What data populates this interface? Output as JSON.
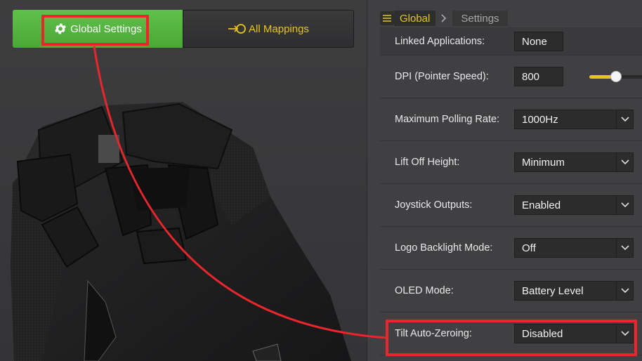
{
  "header": {
    "global_settings_label": "Global Settings",
    "all_mappings_label": "All Mappings"
  },
  "breadcrumb": {
    "global": "Global",
    "settings": "Settings"
  },
  "settings": {
    "linked_applications": {
      "label": "Linked Applications:",
      "value": "None"
    },
    "dpi": {
      "label": "DPI (Pointer Speed):",
      "value": "800",
      "slider_level_percent": 48
    },
    "polling_rate": {
      "label": "Maximum Polling Rate:",
      "value": "1000Hz"
    },
    "lift_off_height": {
      "label": "Lift Off Height:",
      "value": "Minimum"
    },
    "joystick_outputs": {
      "label": "Joystick Outputs:",
      "value": "Enabled"
    },
    "logo_backlight_mode": {
      "label": "Logo Backlight Mode:",
      "value": "Off"
    },
    "oled_mode": {
      "label": "OLED Mode:",
      "value": "Battery Level"
    },
    "tilt_auto_zeroing": {
      "label": "Tilt Auto-Zeroing:",
      "value": "Disabled"
    }
  },
  "colors": {
    "accent_green": "#4fb33b",
    "accent_yellow": "#e8c51a",
    "annotation_red": "#e8262c",
    "panel_bg": "#404042"
  },
  "icons": {
    "global_settings": "gear-icon",
    "all_mappings": "sign-in-icon",
    "breadcrumb_menu": "hamburger-icon",
    "breadcrumb_separator": "chevron-right-icon",
    "dropdown": "chevron-down-icon"
  }
}
